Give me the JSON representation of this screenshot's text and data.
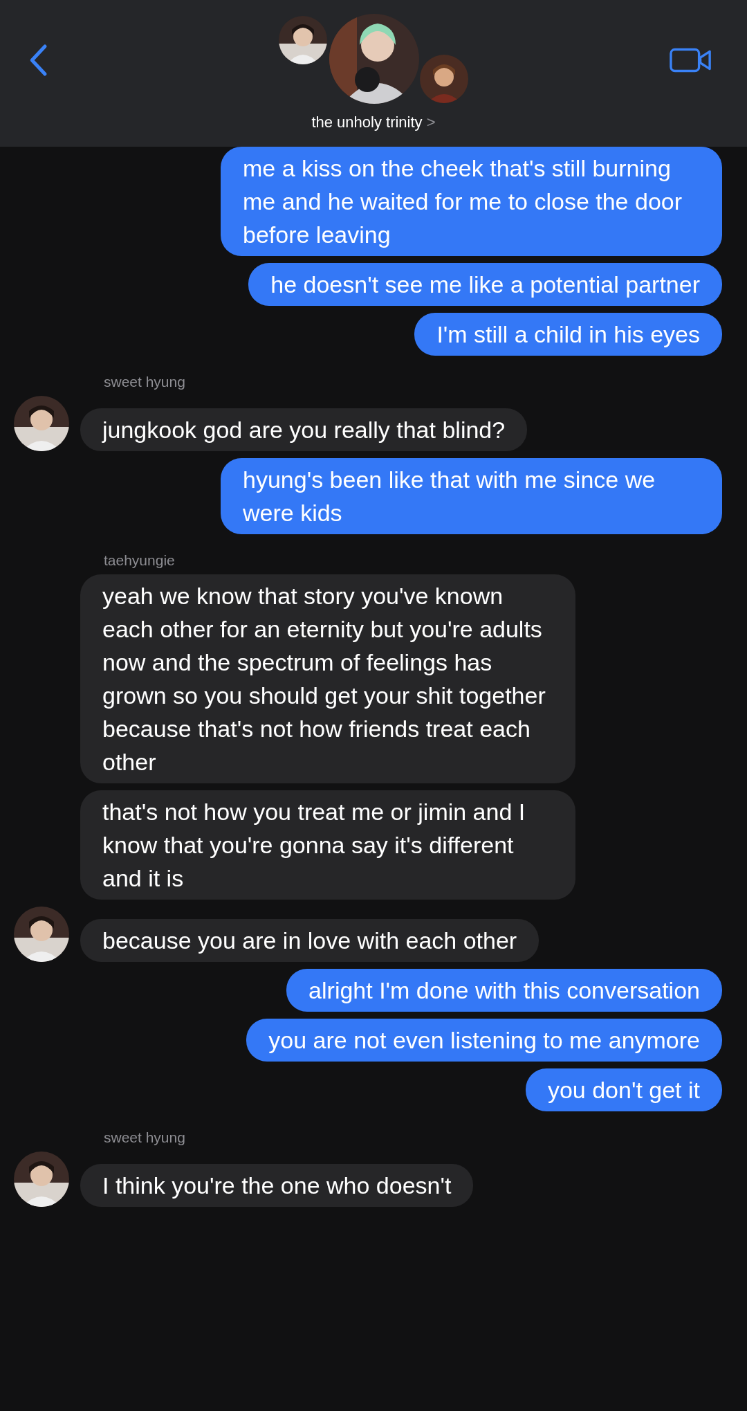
{
  "header": {
    "title": "the unholy trinity",
    "chevron": ">"
  },
  "groups": [
    {
      "kind": "outgoing",
      "messages": [
        "me a kiss on the cheek that's still burning me and he waited for me to close the door before leaving",
        "he doesn't see me like a potential partner",
        "I'm still a child in his eyes"
      ]
    },
    {
      "kind": "incoming",
      "sender": "sweet hyung",
      "messages": [
        "jungkook god are you really that blind?"
      ]
    },
    {
      "kind": "outgoing",
      "messages": [
        "hyung's been like that with me since we were kids"
      ]
    },
    {
      "kind": "incoming",
      "sender": "taehyungie",
      "messages": [
        "yeah we know that story you've known each other for an eternity but you're adults now and the spectrum of feelings has grown so you should get your shit together because that's not how friends treat each other",
        "that's not how you treat me or jimin and I know that you're gonna say it's different and it is",
        "because you are in love with each other"
      ]
    },
    {
      "kind": "outgoing",
      "messages": [
        "alright I'm done with this conversation",
        "you are not even listening to me anymore",
        "you don't get it"
      ]
    },
    {
      "kind": "incoming",
      "sender": "sweet hyung",
      "messages": [
        "I think you're the one who doesn't"
      ]
    }
  ]
}
